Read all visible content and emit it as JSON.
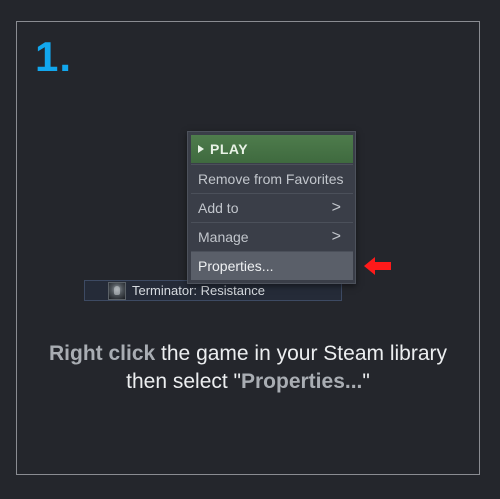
{
  "step": {
    "number": "1."
  },
  "library": {
    "game_title": "Terminator: Resistance",
    "thumbnail_icon": "game-thumbnail-icon"
  },
  "context_menu": {
    "play_label": "PLAY",
    "remove_favorites_label": "Remove from Favorites",
    "add_to_label": "Add to",
    "manage_label": "Manage",
    "properties_label": "Properties...",
    "submenu_glyph": ">"
  },
  "pointer": {
    "icon": "red-arrow-left-icon",
    "color": "#ff1a1a"
  },
  "instruction": {
    "part1_highlight": "Right click",
    "part2": " the game in your Steam library",
    "part3": "then select \"",
    "part4_highlight": "Properties...",
    "part5": "\""
  },
  "colors": {
    "accent_blue": "#12a7ee",
    "play_green": "#4e7c4c",
    "background": "#24262c",
    "highlight_gray": "#a9adb3"
  }
}
